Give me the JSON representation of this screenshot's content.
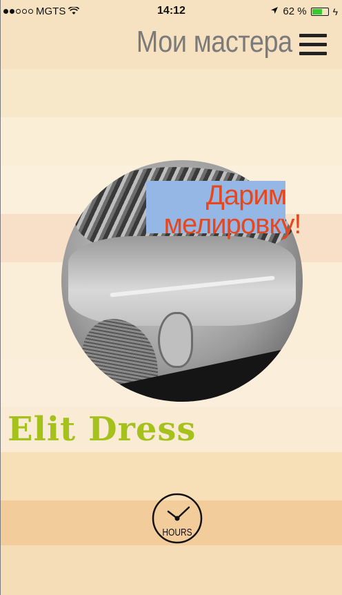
{
  "status_bar": {
    "carrier": "MGTS",
    "time": "14:12",
    "battery": "62 %",
    "battery_level": 0.62
  },
  "header": {
    "title": "Мои мастера",
    "menu_icon": "hamburger-menu-icon"
  },
  "promo": {
    "line1": "Дарим",
    "line2": "мелировку!"
  },
  "master": {
    "name": "Elit Dress",
    "photo": "master-photo"
  },
  "hours": {
    "label": "HOURS",
    "icon": "clock-icon"
  },
  "colors": {
    "title": "#7b7b7b",
    "promo_text": "#e8461b",
    "promo_bg": "#94b7e6",
    "brand": "#a5c21c",
    "battery": "#33cc33"
  }
}
